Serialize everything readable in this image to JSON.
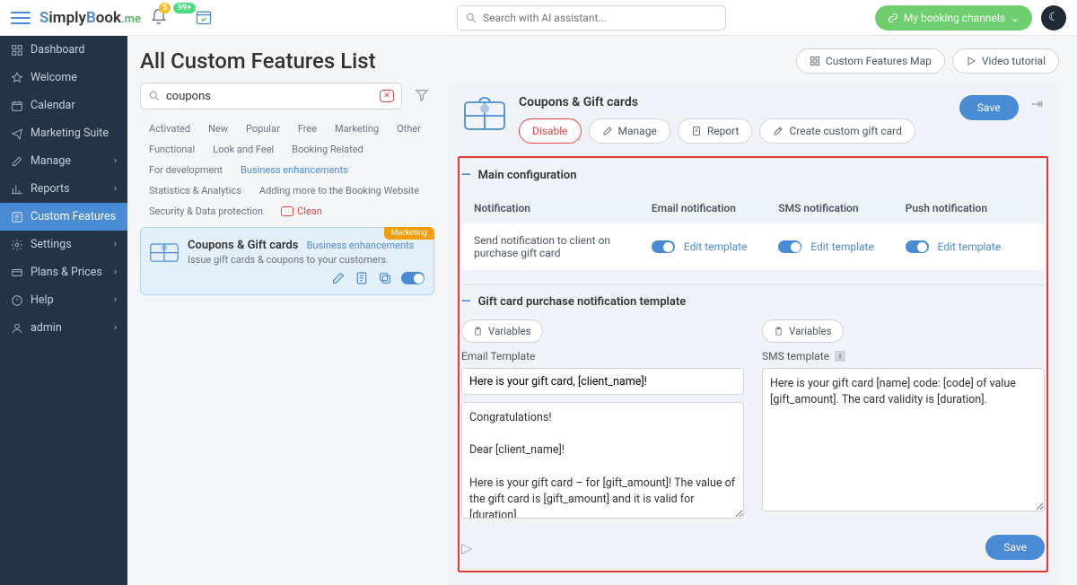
{
  "header": {
    "logo_html": [
      "Simply",
      "Book",
      ".me"
    ],
    "badge_yellow": "5",
    "badge_green": "99+",
    "search_placeholder": "Search with AI assistant...",
    "channels_btn": "My booking channels"
  },
  "sidebar": {
    "items": [
      {
        "label": "Dashboard"
      },
      {
        "label": "Welcome"
      },
      {
        "label": "Calendar"
      },
      {
        "label": "Marketing Suite"
      },
      {
        "label": "Manage",
        "chev": true
      },
      {
        "label": "Reports",
        "chev": true
      },
      {
        "label": "Custom Features",
        "active": true
      },
      {
        "label": "Settings",
        "chev": true
      },
      {
        "label": "Plans & Prices",
        "chev": true
      },
      {
        "label": "Help",
        "chev": true
      },
      {
        "label": "admin",
        "chev": true
      }
    ]
  },
  "page": {
    "title": "All Custom Features List",
    "btn_map": "Custom Features Map",
    "btn_video": "Video tutorial"
  },
  "left": {
    "search_value": "coupons",
    "categories": [
      {
        "label": "Activated"
      },
      {
        "label": "New"
      },
      {
        "label": "Popular"
      },
      {
        "label": "Free"
      },
      {
        "label": "Marketing"
      },
      {
        "label": "Other"
      },
      {
        "label": "Functional"
      },
      {
        "label": "Look and Feel"
      },
      {
        "label": "Booking Related"
      },
      {
        "label": "For development"
      },
      {
        "label": "Business enhancements",
        "blue": true
      },
      {
        "label": "Statistics & Analytics"
      },
      {
        "label": "Adding more to the Booking Website"
      },
      {
        "label": "Security & Data protection"
      }
    ],
    "clean_label": "Clean",
    "card": {
      "tag": "Marketing",
      "title": "Coupons & Gift cards",
      "cat": "Business enhancements",
      "desc": "Issue gift cards & coupons to your customers."
    }
  },
  "panel": {
    "title": "Coupons & Gift cards",
    "btn_disable": "Disable",
    "btn_manage": "Manage",
    "btn_report": "Report",
    "btn_create": "Create custom gift card",
    "btn_save": "Save",
    "sec_main": "Main configuration",
    "notif": {
      "head_notification": "Notification",
      "head_email": "Email notification",
      "head_sms": "SMS notification",
      "head_push": "Push notification",
      "row_label": "Send notification to client on purchase gift card",
      "edit": "Edit template"
    },
    "sec_tmpl": "Gift card purchase notification template",
    "var_btn": "Variables",
    "email_label": "Email Template",
    "sms_label": "SMS template",
    "email_subject": "Here is your gift card, [client_name]!",
    "email_body": "Congratulations!\n\nDear [client_name]!\n\nHere is your gift card – for [gift_amount]! The value of the gift card is [gift_amount] and it is valid for [duration].\n\nPlease use the code [code] to redeem your gift card.  If",
    "sms_body": "Here is your gift card [name] code: [code] of value [gift_amount]. The card validity is [duration].",
    "btn_save2": "Save"
  }
}
